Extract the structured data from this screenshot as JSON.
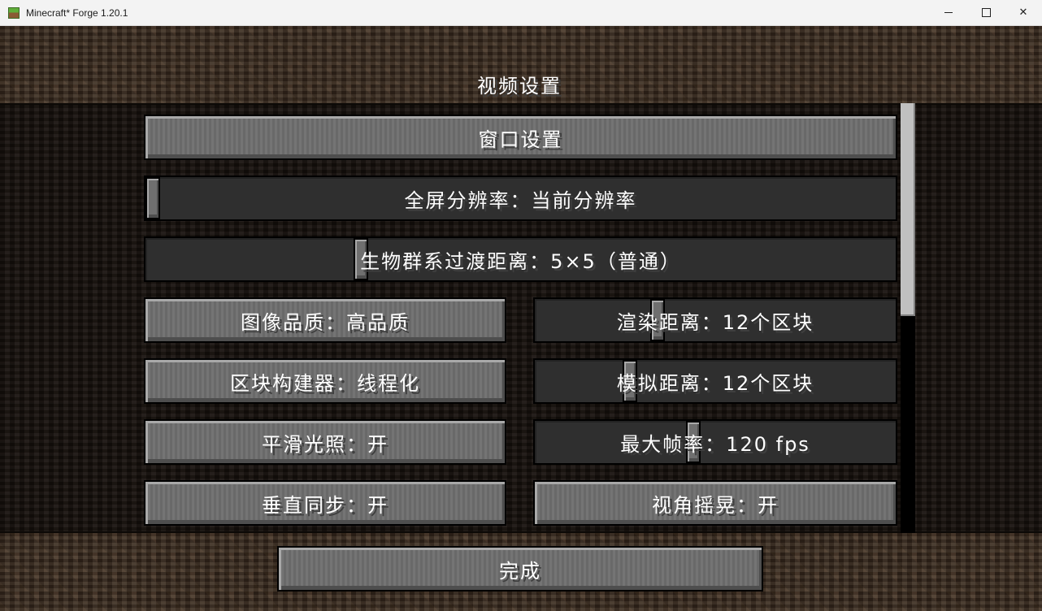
{
  "window": {
    "title": "Minecraft* Forge 1.20.1",
    "controls": {
      "minimize": "",
      "maximize": "",
      "close": "✕"
    }
  },
  "screen": {
    "title": "视频设置"
  },
  "options": {
    "window_settings": "窗口设置",
    "fullscreen_resolution": {
      "label": "全屏分辨率：当前分辨率",
      "level": 0.0
    },
    "biome_blend": {
      "label": "生物群系过渡距离：5×5（普通）",
      "level": 0.29
    },
    "graphics": "图像品质：高品质",
    "render_distance": {
      "label": "渲染距离：12个区块",
      "level": 0.33
    },
    "chunk_builder": "区块构建器：线程化",
    "simulation_distance": {
      "label": "模拟距离：12个区块",
      "level": 0.26
    },
    "smooth_lighting": "平滑光照：开",
    "max_framerate": {
      "label": "最大帧率：120 fps",
      "level": 0.45
    },
    "vsync": "垂直同步：开",
    "view_bobbing": "视角摇晃：开"
  },
  "footer": {
    "done": "完成"
  },
  "scroll": {
    "position": 0.0,
    "visible_fraction": 0.5
  }
}
